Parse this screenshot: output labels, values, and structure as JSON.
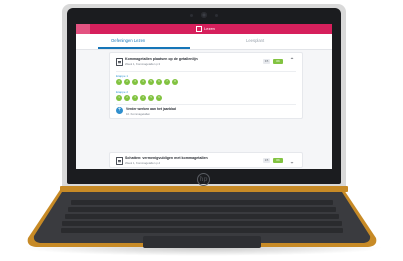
{
  "app": {
    "title": "Lezen"
  },
  "tabs": [
    {
      "label": "Oefeningen Lezen",
      "active": true
    },
    {
      "label": "Leesplant",
      "active": false
    }
  ],
  "lesson": {
    "title": "Kommagetallen plaatsen op de getallenlijn",
    "subtitle": "Week 1, Kommagetallen p.3",
    "score_label": "3/5",
    "status_label": "OK"
  },
  "stages": [
    {
      "label": "Etappe 1",
      "dots": [
        "1",
        "2",
        "3",
        "4",
        "5",
        "6",
        "7",
        "8"
      ]
    },
    {
      "label": "Etappe 2",
      "dots": [
        "1",
        "2",
        "3",
        "4",
        "5",
        "6"
      ]
    }
  ],
  "next": {
    "title": "Verder werken aan het jaarblad",
    "subtitle": "10. Kommagetallen"
  },
  "lesson2": {
    "title": "Schatten: vermenigvuldigen met kommagetallen",
    "subtitle": "Week 1, Kommagetallen p.4",
    "score_label": "2/5",
    "status_label": "OK"
  },
  "laptop": {
    "brand": "hp"
  },
  "colors": {
    "topbar": "#d6205c",
    "tab_active": "#1676b8",
    "success": "#82c341",
    "chassis_trim": "#c78a26"
  }
}
